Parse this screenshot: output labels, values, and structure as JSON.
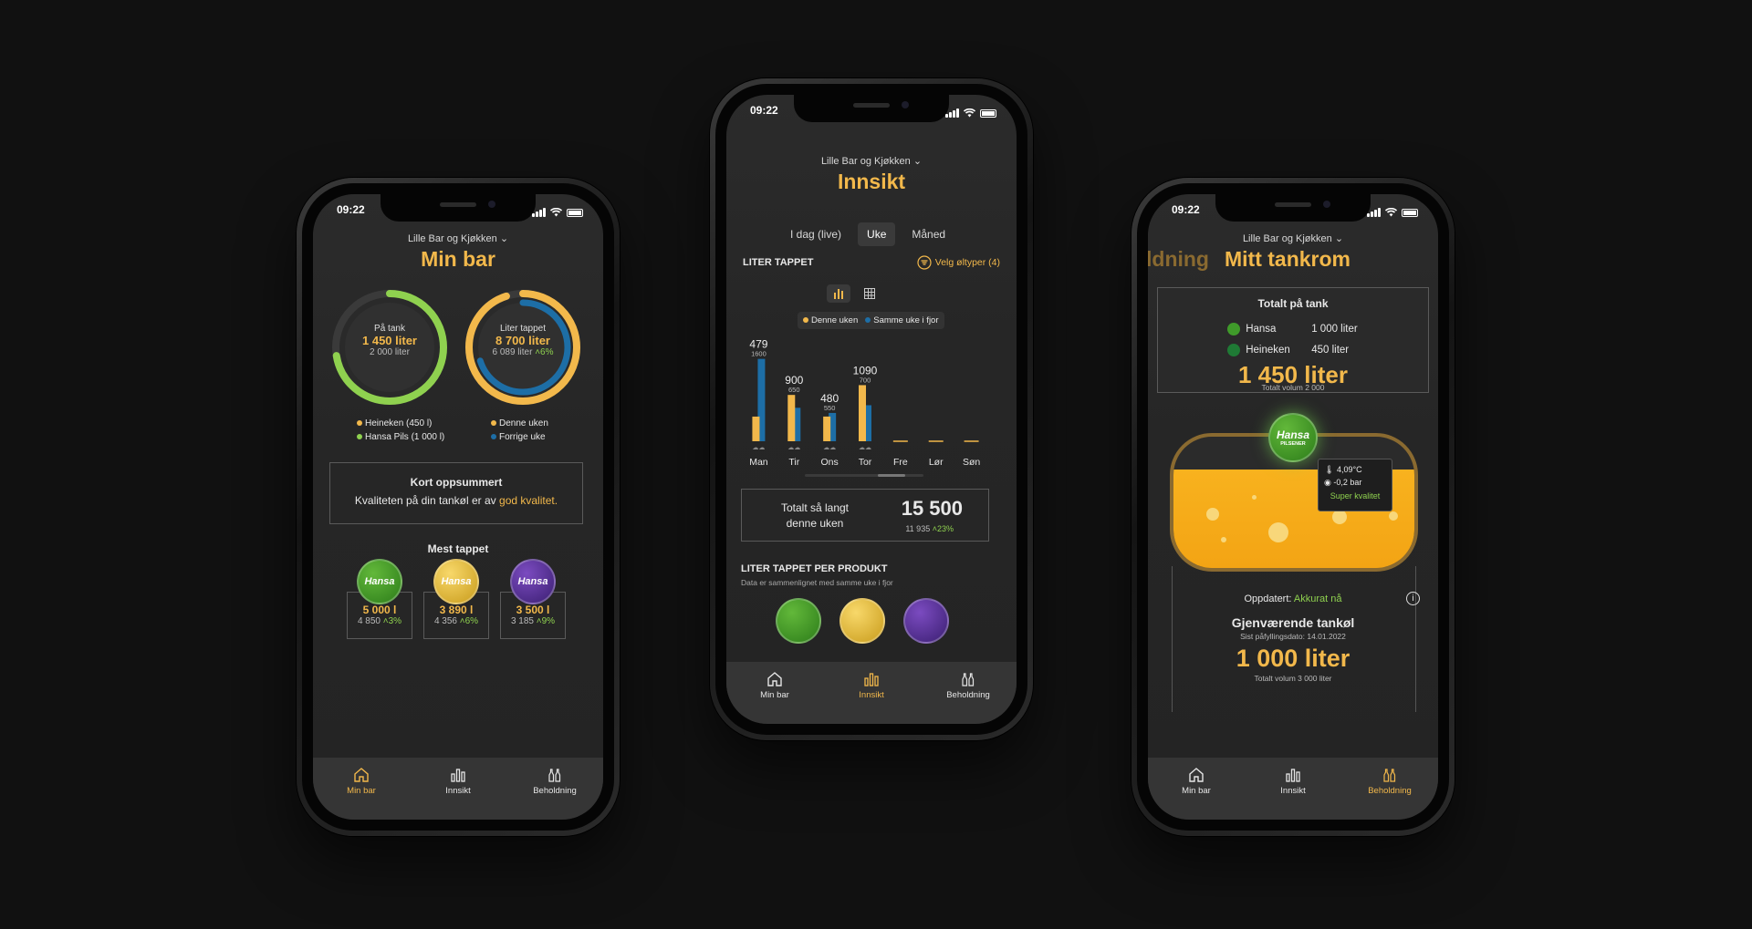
{
  "status": {
    "time": "09:22"
  },
  "tabs": {
    "home": "Min bar",
    "insight": "Innsikt",
    "stock": "Beholdning"
  },
  "colors": {
    "accent": "#f2b84b",
    "green": "#8fd14f",
    "blue": "#1d6ea6",
    "background": "#111111"
  },
  "left": {
    "venue": "Lille Bar og Kjøkken",
    "title": "Min bar",
    "ring1": {
      "label": "På tank",
      "value": "1 450 liter",
      "sub": "2 000 liter",
      "fill_fraction": 0.725
    },
    "ring2": {
      "label": "Liter tappet",
      "value": "8 700 liter",
      "sub": "6 089 liter",
      "delta": "6%",
      "fill_fraction": 0.95,
      "inner_fraction": 0.7
    },
    "legend1": [
      "Heineken (450 l)",
      "Hansa Pils (1 000 l)"
    ],
    "legend2": [
      "Denne uken",
      "Forrige uke"
    ],
    "summary": {
      "heading": "Kort oppsummert",
      "text": "Kvaliteten på din tankøl er av",
      "highlight": "god kvalitet."
    },
    "most_title": "Mest tappet",
    "products": [
      {
        "badge": "Hansa",
        "value": "5 000 l",
        "prev": "4 850",
        "delta": "3%"
      },
      {
        "badge": "Hansa",
        "value": "3 890 l",
        "prev": "4 356",
        "delta": "6%"
      },
      {
        "badge": "Hansa",
        "value": "3 500 l",
        "prev": "3 185",
        "delta": "9%"
      }
    ]
  },
  "middle": {
    "venue": "Lille Bar og Kjøkken",
    "title": "Innsikt",
    "segments": [
      "I dag (live)",
      "Uke",
      "Måned"
    ],
    "section_label": "LITER TAPPET",
    "filter_label": "Velg øltyper (4)",
    "legend": [
      "Denne uken",
      "Samme uke i fjor"
    ],
    "chart_data": {
      "type": "bar",
      "categories": [
        "Man",
        "Tir",
        "Ons",
        "Tor",
        "Fre",
        "Lør",
        "Søn"
      ],
      "series": [
        {
          "name": "Denne uken",
          "values": [
            479,
            900,
            480,
            1090,
            0,
            0,
            0
          ]
        },
        {
          "name": "Samme uke i fjor",
          "values": [
            1600,
            650,
            550,
            700,
            0,
            0,
            0
          ]
        }
      ],
      "ylim": [
        0,
        1700
      ]
    },
    "total": {
      "label": "Totalt så langt denne uken",
      "value": "15 500",
      "prev": "11 935",
      "delta": "23%"
    },
    "per_product": {
      "heading": "LITER TAPPET PER PRODUKT",
      "sub": "Data er sammenlignet med samme uke i fjor"
    }
  },
  "right": {
    "venue": "Lille Bar og Kjøkken",
    "prev_title": "ldning",
    "title": "Mitt tankrom",
    "tank_box": {
      "heading": "Totalt på tank",
      "rows": [
        {
          "name": "Hansa",
          "value": "1 000 liter"
        },
        {
          "name": "Heineken",
          "value": "450 liter"
        }
      ],
      "total": "1 450 liter",
      "sub": "Totalt volum 2 000"
    },
    "tank": {
      "badge": "Hansa",
      "badge_sub": "PILSENER",
      "temp": "4,09°C",
      "pressure": "-0,2 bar",
      "quality": "Super kvalitet",
      "fill_fraction": 0.75
    },
    "updated_label": "Oppdatert:",
    "updated_value": "Akkurat nå",
    "remaining": {
      "heading": "Gjenværende tankøl",
      "sub": "Sist påfyllingsdato: 14.01.2022",
      "value": "1 000 liter",
      "total": "Totalt volum 3 000 liter"
    }
  }
}
